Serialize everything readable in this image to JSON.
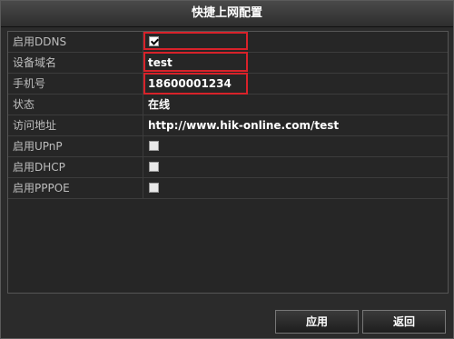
{
  "dialog": {
    "title": "快捷上网配置"
  },
  "settings": [
    {
      "label": "启用DDNS",
      "type": "checkbox",
      "checked": true
    },
    {
      "label": "设备域名",
      "type": "text",
      "value": "test"
    },
    {
      "label": "手机号",
      "type": "text",
      "value": "18600001234"
    },
    {
      "label": "状态",
      "type": "text",
      "value": "在线"
    },
    {
      "label": "访问地址",
      "type": "text",
      "value": "http://www.hik-online.com/test"
    },
    {
      "label": "启用UPnP",
      "type": "checkbox",
      "checked": false
    },
    {
      "label": "启用DHCP",
      "type": "checkbox",
      "checked": false
    },
    {
      "label": "启用PPPOE",
      "type": "checkbox",
      "checked": false
    }
  ],
  "buttons": {
    "apply_label": "应用",
    "back_label": "返回"
  },
  "colors": {
    "highlight": "#d8222a",
    "background": "#2b2b2b"
  }
}
